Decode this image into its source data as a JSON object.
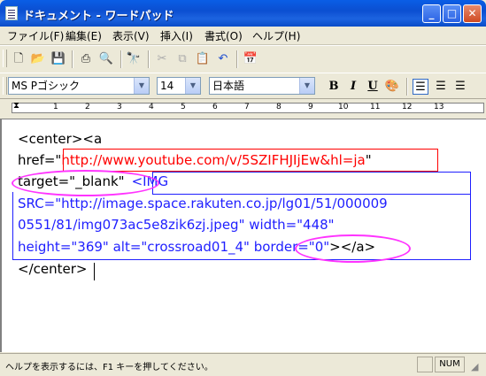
{
  "window": {
    "title": "ドキュメント - ワードパッド"
  },
  "title_buttons": {
    "minimize": "_",
    "maximize": "□",
    "close": "✕"
  },
  "menu": [
    "ファイル(F)",
    "編集(E)",
    "表示(V)",
    "挿入(I)",
    "書式(O)",
    "ヘルプ(H)"
  ],
  "toolbar_icons": [
    "new-document-icon",
    "open-folder-icon",
    "save-icon",
    "print-icon",
    "print-preview-icon",
    "find-icon",
    "cut-icon",
    "copy-icon",
    "paste-icon",
    "undo-icon",
    "insert-date-time-icon"
  ],
  "format": {
    "font": "MS Pゴシック",
    "size": "14",
    "script": "日本語",
    "bold": "B",
    "italic": "I",
    "underline": "U"
  },
  "ruler": {
    "numbers": [
      "1",
      "2",
      "3",
      "4",
      "5",
      "6",
      "7",
      "8",
      "9",
      "10",
      "11",
      "12",
      "13"
    ]
  },
  "document": {
    "line1": "<center><a",
    "line2_prefix": "href=\"",
    "line2_url": "http://www.youtube.com/v/5SZIFHJIjEw&hl=ja",
    "line2_suffix": "\"",
    "line3_target": "target=\"_blank\"",
    "line3_img": "<IMG",
    "line4": "SRC=\"http://image.space.rakuten.co.jp/lg01/51/000009",
    "line5": "0551/81/img073ac5e8zik6zj.jpeg\" width=\"448\"",
    "line6_main": "height=\"369\" alt=\"crossroad01_4\"",
    "line6_border": "border=\"0\"",
    "line6_end": "></a>",
    "line7": "</center>"
  },
  "annotation_colors": {
    "url_box": "#ff0000",
    "img_box": "#1f1fff",
    "ellipse": "#ff33ff"
  },
  "status": {
    "help": "ヘルプを表示するには、F1 キーを押してください。",
    "num": "NUM"
  }
}
